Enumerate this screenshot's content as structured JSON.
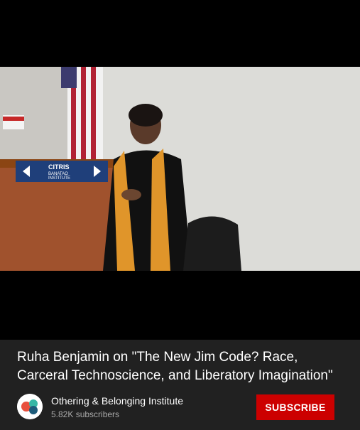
{
  "video": {
    "title": "Ruha Benjamin on \"The New Jim Code? Race, Carceral Technoscience, and Liberatory Imagination\"",
    "podium_sign_line1": "CITRIS",
    "podium_sign_line2": "BANATAO",
    "podium_sign_line3": "INSTITUTE"
  },
  "channel": {
    "name": "Othering & Belonging Institute",
    "subscribers": "5.82K subscribers",
    "avatar_icon": "othering-belonging-logo-icon"
  },
  "actions": {
    "subscribe_label": "SUBSCRIBE",
    "subscribe_color": "#cc0000"
  }
}
